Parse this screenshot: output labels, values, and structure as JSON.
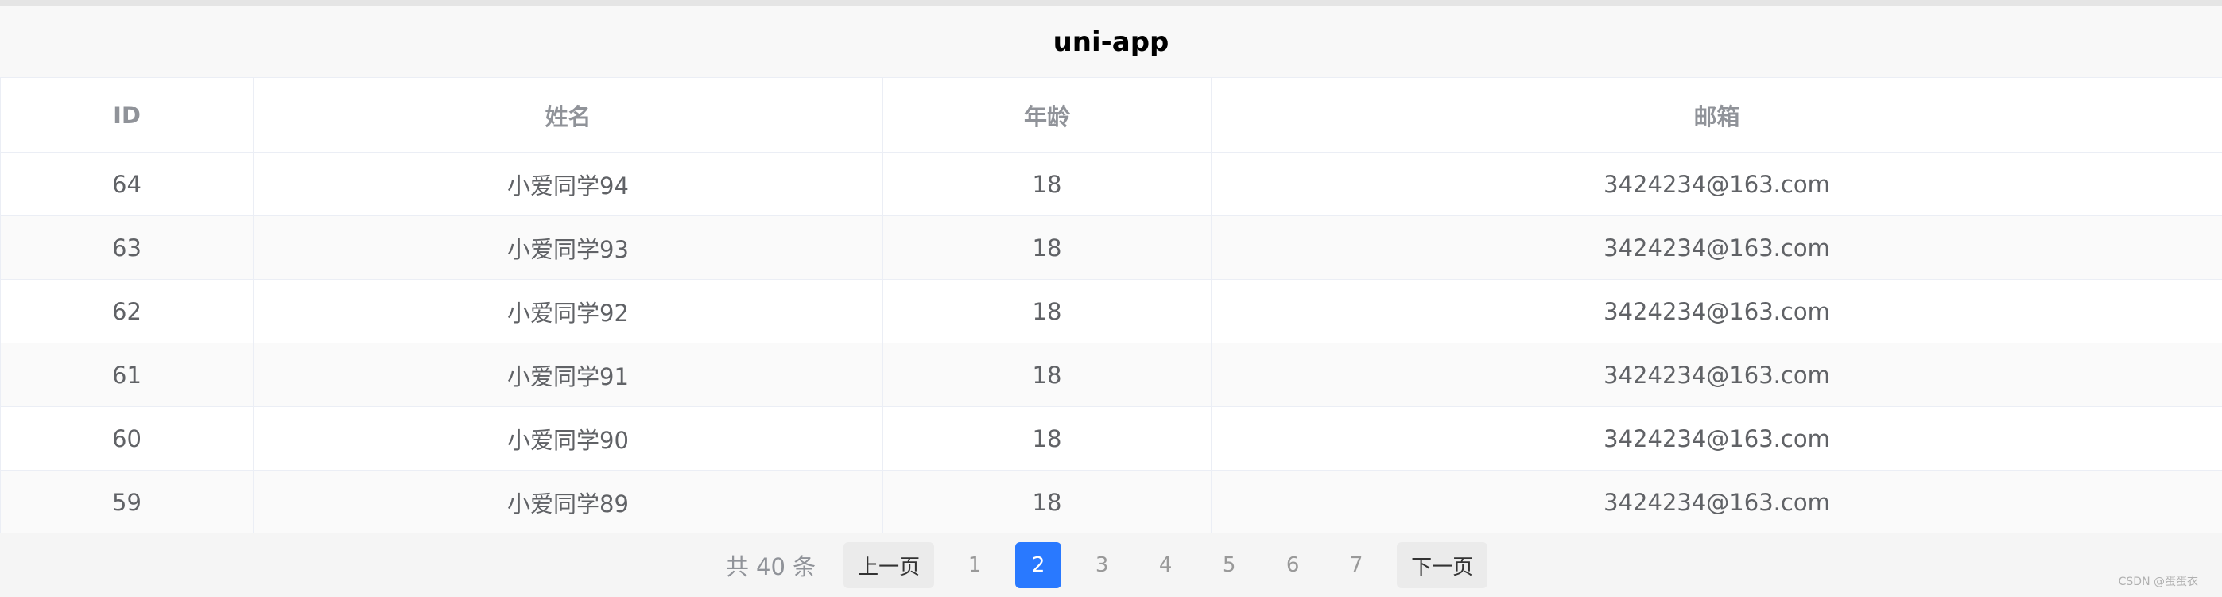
{
  "nav": {
    "title": "uni-app"
  },
  "table": {
    "headers": [
      "ID",
      "姓名",
      "年龄",
      "邮箱"
    ],
    "rows": [
      [
        "64",
        "小爱同学94",
        "18",
        "3424234@163.com"
      ],
      [
        "63",
        "小爱同学93",
        "18",
        "3424234@163.com"
      ],
      [
        "62",
        "小爱同学92",
        "18",
        "3424234@163.com"
      ],
      [
        "61",
        "小爱同学91",
        "18",
        "3424234@163.com"
      ],
      [
        "60",
        "小爱同学90",
        "18",
        "3424234@163.com"
      ],
      [
        "59",
        "小爱同学89",
        "18",
        "3424234@163.com"
      ]
    ]
  },
  "pagination": {
    "total_text": "共 40 条",
    "prev_label": "上一页",
    "next_label": "下一页",
    "pages": [
      "1",
      "2",
      "3",
      "4",
      "5",
      "6",
      "7"
    ],
    "current": "2",
    "active_color": "#2979ff"
  },
  "watermark": "CSDN @蛋蛋衣"
}
